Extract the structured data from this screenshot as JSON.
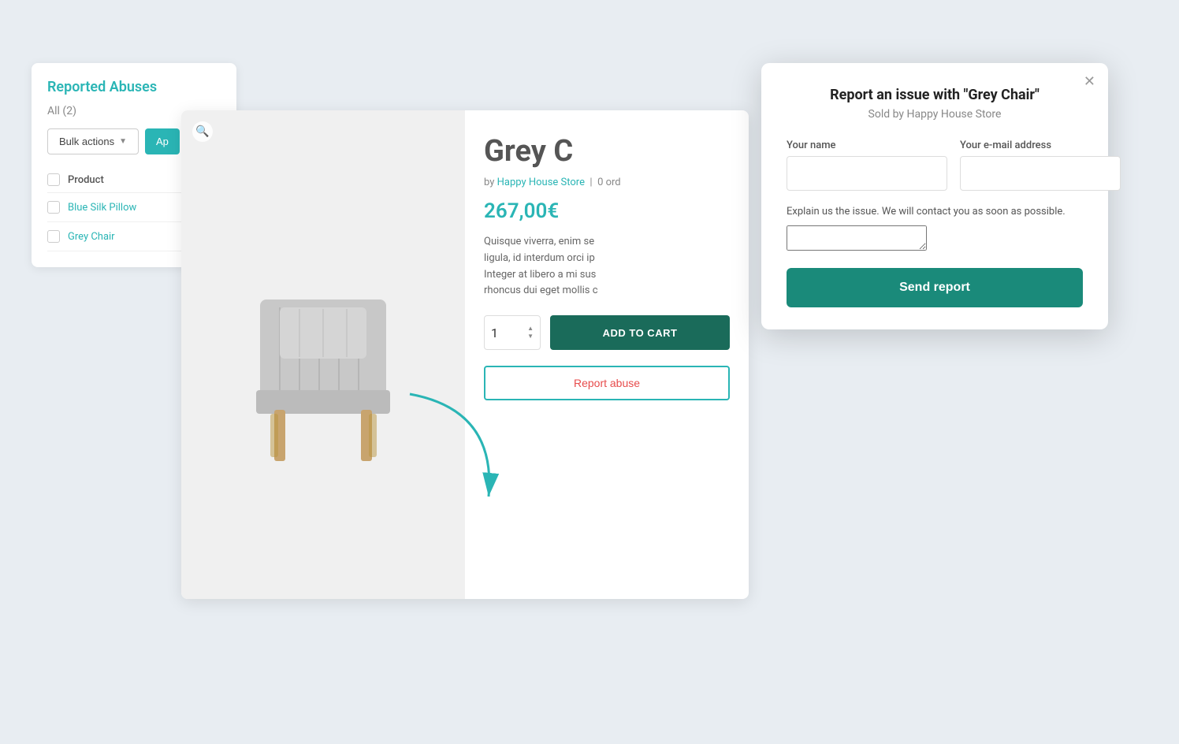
{
  "admin": {
    "title": "Reported Abuses",
    "filter_label": "All (2)",
    "bulk_actions_label": "Bulk actions",
    "apply_label": "Ap",
    "table_header": "Product",
    "rows": [
      {
        "name": "Blue Silk Pillow"
      },
      {
        "name": "Grey Chair"
      }
    ]
  },
  "product": {
    "name": "Grey C",
    "full_name": "Grey Chair",
    "seller": "Happy House Store",
    "orders": "0 ord",
    "price": "267,00€",
    "description_line1": "Quisque viverra, enim se",
    "description_line2": "ligula, id interdum orci ip",
    "description_line3": "Integer at libero a mi sus",
    "description_line4": "rhoncus dui eget mollis c",
    "quantity": "1",
    "add_to_cart_label": "ADD TO CART",
    "report_abuse_label": "Report abuse",
    "zoom_icon": "🔍"
  },
  "modal": {
    "title": "Report an issue with \"Grey Chair\"",
    "subtitle": "Sold by Happy House Store",
    "name_label": "Your name",
    "email_label": "Your e-mail address",
    "issue_label": "Explain us the issue. We will contact you as soon as possible.",
    "send_label": "Send report",
    "name_placeholder": "",
    "email_placeholder": "",
    "issue_placeholder": "",
    "close_icon": "✕"
  },
  "colors": {
    "teal": "#2ab5b5",
    "dark_teal": "#1a8a7a",
    "price_teal": "#2ab5b5",
    "report_red": "#e74c4c"
  }
}
